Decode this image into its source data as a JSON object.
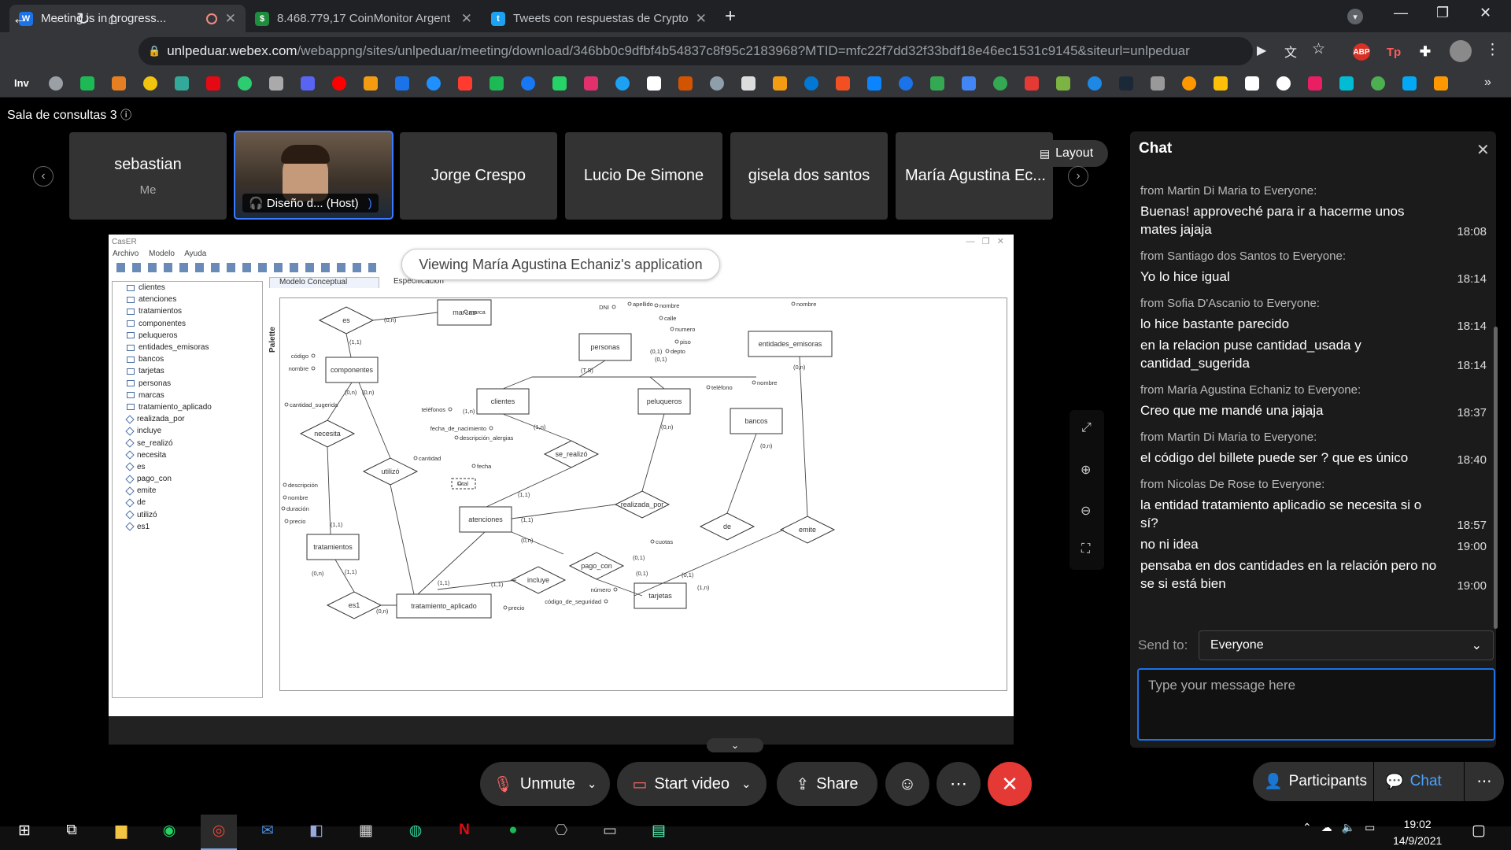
{
  "browser": {
    "tabs": [
      {
        "title": "Meeting is in progress...",
        "icon": "webex-icon",
        "active": true
      },
      {
        "title": "8.468.779,17 CoinMonitor Argent",
        "icon": "coinmonitor-icon",
        "active": false
      },
      {
        "title": "Tweets con respuestas de Crypto",
        "icon": "twitter-icon",
        "active": false
      }
    ],
    "url_host": "unlpeduar.webex.com",
    "url_path": "/webappng/sites/unlpeduar/meeting/download/346bb0c9dfbf4b54837c8f95c2183968?MTID=mfc22f7dd32f33bdf18e46ec1531c9145&siteurl=unlpeduar",
    "bookmark_first": "Inv"
  },
  "meeting": {
    "room_name": "Sala de consultas 3",
    "participants": [
      {
        "name": "sebastian",
        "sub": "Me"
      },
      {
        "name": "Diseño d...",
        "sub": "(Host)"
      },
      {
        "name": "Jorge Crespo"
      },
      {
        "name": "Lucio De Simone"
      },
      {
        "name": "gisela dos santos"
      },
      {
        "name": "María Agustina Ec..."
      }
    ],
    "layout_label": "Layout",
    "viewing_label": "Viewing María Agustina Echaniz's application"
  },
  "app": {
    "title": "CasER",
    "menu": [
      "Archivo",
      "Modelo",
      "Ayuda"
    ],
    "tabs": [
      "Modelo Conceptual",
      "Especificación"
    ],
    "palette_label": "Palette",
    "tree_entities": [
      "clientes",
      "atenciones",
      "tratamientos",
      "componentes",
      "peluqueros",
      "entidades_emisoras",
      "bancos",
      "tarjetas",
      "personas",
      "marcas",
      "tratamiento_aplicado"
    ],
    "tree_relations": [
      "realizada_por",
      "incluye",
      "se_realizó",
      "necesita",
      "es",
      "pago_con",
      "emite",
      "de",
      "utilizó",
      "es1"
    ]
  },
  "diagram": {
    "entities": [
      "marcas",
      "personas",
      "entidades_emisoras",
      "componentes",
      "clientes",
      "peluqueros",
      "bancos",
      "atenciones",
      "tratamientos",
      "tarjetas",
      "tratamiento_aplicado"
    ],
    "relations": [
      "es",
      "necesita",
      "utilizó",
      "se_realizó",
      "realizada_por",
      "de",
      "emite",
      "pago_con",
      "incluye",
      "es1"
    ],
    "attributes": [
      "marca",
      "DNI",
      "apellido",
      "nombre",
      "calle",
      "numero",
      "piso",
      "depto",
      "código",
      "nombre",
      "cantidad_sugerida",
      "teléfonos",
      "fecha_de_nacimiento",
      "descripción_alergias",
      "teléfono",
      "nombre",
      "nombre",
      "cantidad",
      "fecha",
      "total",
      "descripción",
      "nombre",
      "duración",
      "precio",
      "cuotas",
      "número",
      "código_de_seguridad",
      "precio"
    ],
    "cardinalities": [
      "(0,n)",
      "(1,1)",
      "(0,n)",
      "(0,n)",
      "(1,n)",
      "(T,S)",
      "(0,1)",
      "(0,1)",
      "(0,n)",
      "(0,n)",
      "(1,n)",
      "(0,n)",
      "(1,1)",
      "(1,1)",
      "(0,n)",
      "(0,1)",
      "(0,1)",
      "(0,1)",
      "(1,n)",
      "(1,1)",
      "(1,1)",
      "(0,n)",
      "(1,1)",
      "(1,1)",
      "(0,n)"
    ]
  },
  "chat": {
    "title": "Chat",
    "messages": [
      {
        "from": "from Martin Di Maria to Everyone:",
        "lines": [
          {
            "text": "Buenas! approveché para ir a hacerme unos mates jajaja",
            "time": "18:08"
          }
        ]
      },
      {
        "from": "from Santiago dos Santos to Everyone:",
        "lines": [
          {
            "text": "Yo lo hice igual",
            "time": "18:14"
          }
        ]
      },
      {
        "from": "from Sofia D'Ascanio to Everyone:",
        "lines": [
          {
            "text": "lo hice bastante parecido",
            "time": "18:14"
          },
          {
            "text": "en la relacion puse cantidad_usada y cantidad_sugerida",
            "time": "18:14"
          }
        ]
      },
      {
        "from": "from María Agustina Echaniz to Everyone:",
        "lines": [
          {
            "text": "Creo que me mandé una jajaja",
            "time": "18:37"
          }
        ]
      },
      {
        "from": "from Martin Di Maria to Everyone:",
        "lines": [
          {
            "text": "el código del billete puede ser ? que es único",
            "time": "18:40"
          }
        ]
      },
      {
        "from": "from Nicolas De Rose to Everyone:",
        "lines": [
          {
            "text": "la entidad tratamiento aplicadio se necesita si o sí?",
            "time": "18:57"
          },
          {
            "text": "no ni idea",
            "time": "19:00"
          },
          {
            "text": "pensaba en dos cantidades en la relación pero no se si está bien",
            "time": "19:00"
          }
        ]
      }
    ],
    "send_to_label": "Send to:",
    "send_to_value": "Everyone",
    "input_placeholder": "Type your message here"
  },
  "controls": {
    "unmute": "Unmute",
    "start_video": "Start video",
    "share": "Share",
    "participants": "Participants",
    "chat": "Chat"
  },
  "taskbar": {
    "time": "19:02",
    "date": "14/9/2021"
  },
  "colors": {
    "accent": "#1a73e8",
    "leave": "#e53935",
    "host_border": "#3b7bff"
  }
}
